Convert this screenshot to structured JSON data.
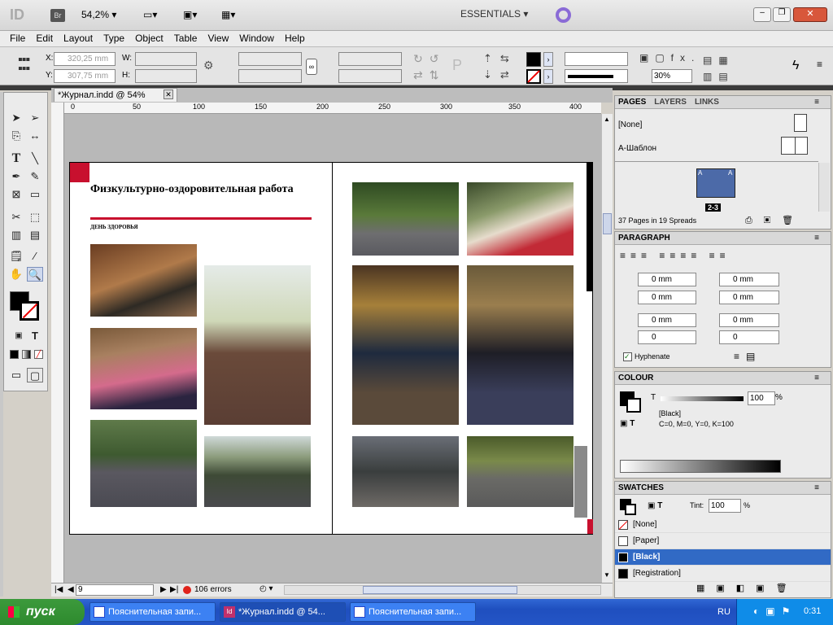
{
  "app": {
    "logo": "ID",
    "bridge": "Br",
    "zoom": "54,2%",
    "workspace": "ESSENTIALS"
  },
  "menu": [
    "File",
    "Edit",
    "Layout",
    "Type",
    "Object",
    "Table",
    "View",
    "Window",
    "Help"
  ],
  "control": {
    "x": "320,25 mm",
    "y": "307,75 mm",
    "x_label": "X:",
    "y_label": "Y:",
    "w_label": "W:",
    "h_label": "H:",
    "opacity": "30%"
  },
  "tab": {
    "title": "*Журнал.indd @ 54%"
  },
  "ruler": {
    "h": [
      "0",
      "50",
      "100",
      "150",
      "200",
      "250",
      "300",
      "350",
      "400"
    ]
  },
  "document": {
    "heading": "Физкультурно-оздоровительная работа",
    "subheading": "ДЕНЬ ЗДОРОВЬЯ"
  },
  "status": {
    "page": "9",
    "errors": "106 errors"
  },
  "pages_panel": {
    "tabs": [
      "PAGES",
      "LAYERS",
      "LINKS"
    ],
    "none": "[None]",
    "master": "А-Шаблон",
    "spread_label": "2-3",
    "count": "37 Pages in 19 Spreads"
  },
  "paragraph": {
    "title": "PARAGRAPH",
    "fields": [
      "0 mm",
      "0 mm",
      "0 mm",
      "0 mm",
      "0 mm",
      "0 mm",
      "0",
      "0"
    ],
    "hyphenate": "Hyphenate"
  },
  "colour": {
    "title": "COLOUR",
    "tint_label": "T",
    "tint": "100",
    "pct": "%",
    "name": "[Black]",
    "values": "C=0, M=0, Y=0, K=100"
  },
  "swatches": {
    "title": "SWATCHES",
    "tint_label": "Tint:",
    "tint": "100",
    "pct": "%",
    "items": [
      "[None]",
      "[Paper]",
      "[Black]",
      "[Registration]"
    ]
  },
  "taskbar": {
    "start": "пуск",
    "buttons": [
      "Пояснительная запи...",
      "*Журнал.indd @ 54...",
      "Пояснительная запи..."
    ],
    "lang": "RU",
    "time": "0:31"
  }
}
